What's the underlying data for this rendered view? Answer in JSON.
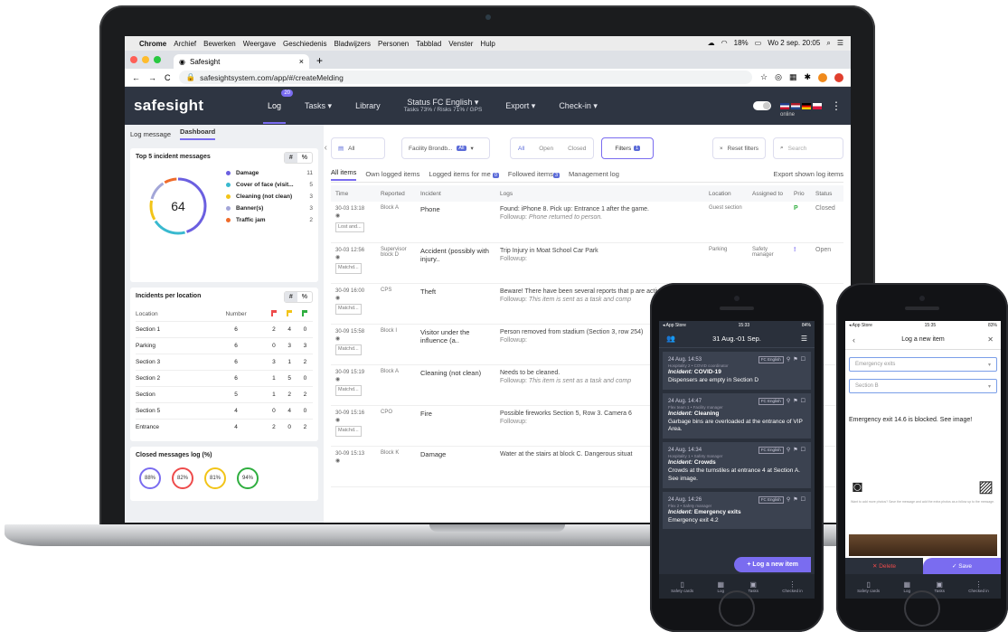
{
  "mac_menubar": {
    "app": "Chrome",
    "items": [
      "Archief",
      "Bewerken",
      "Weergave",
      "Geschiedenis",
      "Bladwijzers",
      "Personen",
      "Tabblad",
      "Venster",
      "Hulp"
    ],
    "battery": "18%",
    "clock": "Wo 2 sep. 20:05"
  },
  "browser": {
    "tab_title": "Safesight",
    "url": "safesightsystem.com/app/#/createMelding"
  },
  "app_nav": {
    "brand": "safesight",
    "log_label": "Log",
    "log_badge": "20",
    "tasks_label": "Tasks ▾",
    "library_label": "Library",
    "status_label": "Status FC English ▾",
    "status_sub": "Tasks 73% / Risks 71% / GPS",
    "export_label": "Export ▾",
    "checkin_label": "Check-in ▾",
    "online_label": "online"
  },
  "left_panel": {
    "tab_log": "Log message",
    "tab_dashboard": "Dashboard",
    "top5": {
      "title": "Top 5 incident messages",
      "toggle_hash": "#",
      "toggle_pct": "%",
      "total": "64",
      "items": [
        {
          "label": "Damage",
          "count": "11",
          "color": "#6b5fe0"
        },
        {
          "label": "Cover of face (visit...",
          "count": "5",
          "color": "#39b9cf"
        },
        {
          "label": "Cleaning (not clean)",
          "count": "3",
          "color": "#f2c418"
        },
        {
          "label": "Banner(s)",
          "count": "3",
          "color": "#a3a6d8"
        },
        {
          "label": "Traffic jam",
          "count": "2",
          "color": "#ef6b2a"
        }
      ]
    },
    "locations": {
      "title": "Incidents per location",
      "toggle_hash": "#",
      "toggle_pct": "%",
      "col_location": "Location",
      "col_number": "Number",
      "rows": [
        {
          "loc": "Section 1",
          "n": "6",
          "r": "2",
          "y": "4",
          "g": "0"
        },
        {
          "loc": "Parking",
          "n": "6",
          "r": "0",
          "y": "3",
          "g": "3"
        },
        {
          "loc": "Section 3",
          "n": "6",
          "r": "3",
          "y": "1",
          "g": "2"
        },
        {
          "loc": "Section 2",
          "n": "6",
          "r": "1",
          "y": "5",
          "g": "0"
        },
        {
          "loc": "Section",
          "n": "5",
          "r": "1",
          "y": "2",
          "g": "2"
        },
        {
          "loc": "Section 5",
          "n": "4",
          "r": "0",
          "y": "4",
          "g": "0"
        },
        {
          "loc": "Entrance",
          "n": "4",
          "r": "2",
          "y": "0",
          "g": "2"
        }
      ]
    },
    "closed": {
      "title": "Closed messages log (%)",
      "rings": [
        {
          "v": "88%",
          "color": "#7a6cf0"
        },
        {
          "v": "82%",
          "color": "#ee4b4b"
        },
        {
          "v": "81%",
          "color": "#f2c418"
        },
        {
          "v": "94%",
          "color": "#2fae3f"
        }
      ]
    }
  },
  "filters": {
    "all_select": "All",
    "facility": "Facility Brondb...",
    "facility_badge": "All",
    "seg_all": "All",
    "seg_open": "Open",
    "seg_closed": "Closed",
    "filters_label": "Filters",
    "filters_badge": "1",
    "reset": "Reset filters",
    "search_placeholder": "Search"
  },
  "list_tabs": {
    "all": "All items",
    "own": "Own logged items",
    "logged_for_me": "Logged items for me",
    "logged_badge": "0",
    "followed": "Followed items",
    "followed_badge": "3",
    "management": "Management log",
    "export": "Export shown log items"
  },
  "grid_headers": [
    "Time",
    "Reported",
    "Incident",
    "Logs",
    "Location",
    "Assigned to",
    "Prio",
    "Status"
  ],
  "grid_rows": [
    {
      "time": "30-03 13:18",
      "tag": "Lost and...",
      "rep": "Block A",
      "subj": "Phone",
      "log": "Found: iPhone 8. Pick up: Entrance 1 after the game.",
      "fu_label": "Followup:",
      "fu": "Phone returned to person.",
      "loc": "Guest section",
      "assigned": "",
      "prio": "P",
      "prio_cls": "prio-g",
      "status": "Closed"
    },
    {
      "time": "30-03 12:56",
      "tag": "Matchd...",
      "rep": "Supervisor block D",
      "subj": "Accident (possibly with injury..",
      "log": "Trip Injury in Moat School Car Park",
      "fu_label": "Followup:",
      "fu": "",
      "loc": "Parking",
      "assigned": "Safety manager",
      "prio": "!",
      "prio_cls": "prio-p",
      "status": "Open"
    },
    {
      "time": "30-09 16:00",
      "tag": "Matchd...",
      "rep": "CPS",
      "subj": "Theft",
      "log": "Beware! There have been several reports that p are active.",
      "fu_label": "Followup:",
      "fu": "This item is sent as a task and comp",
      "loc": "",
      "assigned": "",
      "prio": "",
      "prio_cls": "",
      "status": ""
    },
    {
      "time": "30-09 15:58",
      "tag": "Matchd...",
      "rep": "Block I",
      "subj": "Visitor under the influence (a..",
      "log": "Person removed from stadium (Section 3, row 254)",
      "fu_label": "Followup:",
      "fu": "",
      "loc": "",
      "assigned": "",
      "prio": "",
      "prio_cls": "",
      "status": ""
    },
    {
      "time": "30-09 15:19",
      "tag": "Matchd...",
      "rep": "Block A",
      "subj": "Cleaning (not clean)",
      "log": "Needs to be cleaned.",
      "fu_label": "Followup:",
      "fu": "This item is sent as a task and comp",
      "loc": "",
      "assigned": "",
      "prio": "",
      "prio_cls": "",
      "status": ""
    },
    {
      "time": "30-09 15:16",
      "tag": "Matchd...",
      "rep": "CPO",
      "subj": "Fire",
      "log": "Possible fireworks Section 5, Row 3. Camera 6",
      "fu_label": "Followup:",
      "fu": "",
      "loc": "",
      "assigned": "",
      "prio": "",
      "prio_cls": "",
      "status": ""
    },
    {
      "time": "30-09 15:13",
      "tag": "",
      "rep": "Block K",
      "subj": "Damage",
      "log": "Water at the stairs at block C. Dangerous situat",
      "fu_label": "",
      "fu": "",
      "loc": "",
      "assigned": "",
      "prio": "",
      "prio_cls": "",
      "status": ""
    }
  ],
  "phone1": {
    "carrier": "◂ App Store",
    "time": "15:33",
    "battery": "84%",
    "date_range": "31 Aug.-01 Sep.",
    "incidents": [
      {
        "time": "24 Aug. 14:53",
        "tag": "FC English",
        "sub": "Hospitality 2 • COVID coordinator",
        "kind": "Incident:",
        "title": "COVID-19",
        "body": "Dispensers are empty in Section D"
      },
      {
        "time": "24 Aug. 14:47",
        "tag": "FC English",
        "sub": "Flex team 1 • Facility manager",
        "kind": "Incident:",
        "title": "Cleaning",
        "body": "Garbage bins are overloaded at the entrance of VIP Area."
      },
      {
        "time": "24 Aug. 14:34",
        "tag": "FC English",
        "sub": "Hospitality 1 • Safety manager",
        "kind": "Incident:",
        "title": "Crowds",
        "body": "Crowds at the turnstiles at entrance 4 at Section A. See image."
      },
      {
        "time": "24 Aug. 14:26",
        "tag": "FC English",
        "sub": "Flex 2 • Safety manager",
        "kind": "Incident:",
        "title": "Emergency exits",
        "body": "Emergency exit 4.2"
      }
    ],
    "fab": "+ Log a new item",
    "tabs": [
      "Safety cards",
      "Log",
      "Tasks",
      "Checked in"
    ]
  },
  "phone2": {
    "carrier": "◂ App Store",
    "time": "15:35",
    "battery": "83%",
    "title": "Log a new item",
    "select1": "Emergency exits",
    "select2": "Section B",
    "message": "Emergency exit 14.6 is blocked. See image!",
    "hint": "Want to add more photos? Save the message and add the extra photos as a follow up to the message.",
    "delete": "Delete",
    "save": "Save",
    "tabs": [
      "Safety cards",
      "Log",
      "Tasks",
      "Checked in"
    ]
  }
}
